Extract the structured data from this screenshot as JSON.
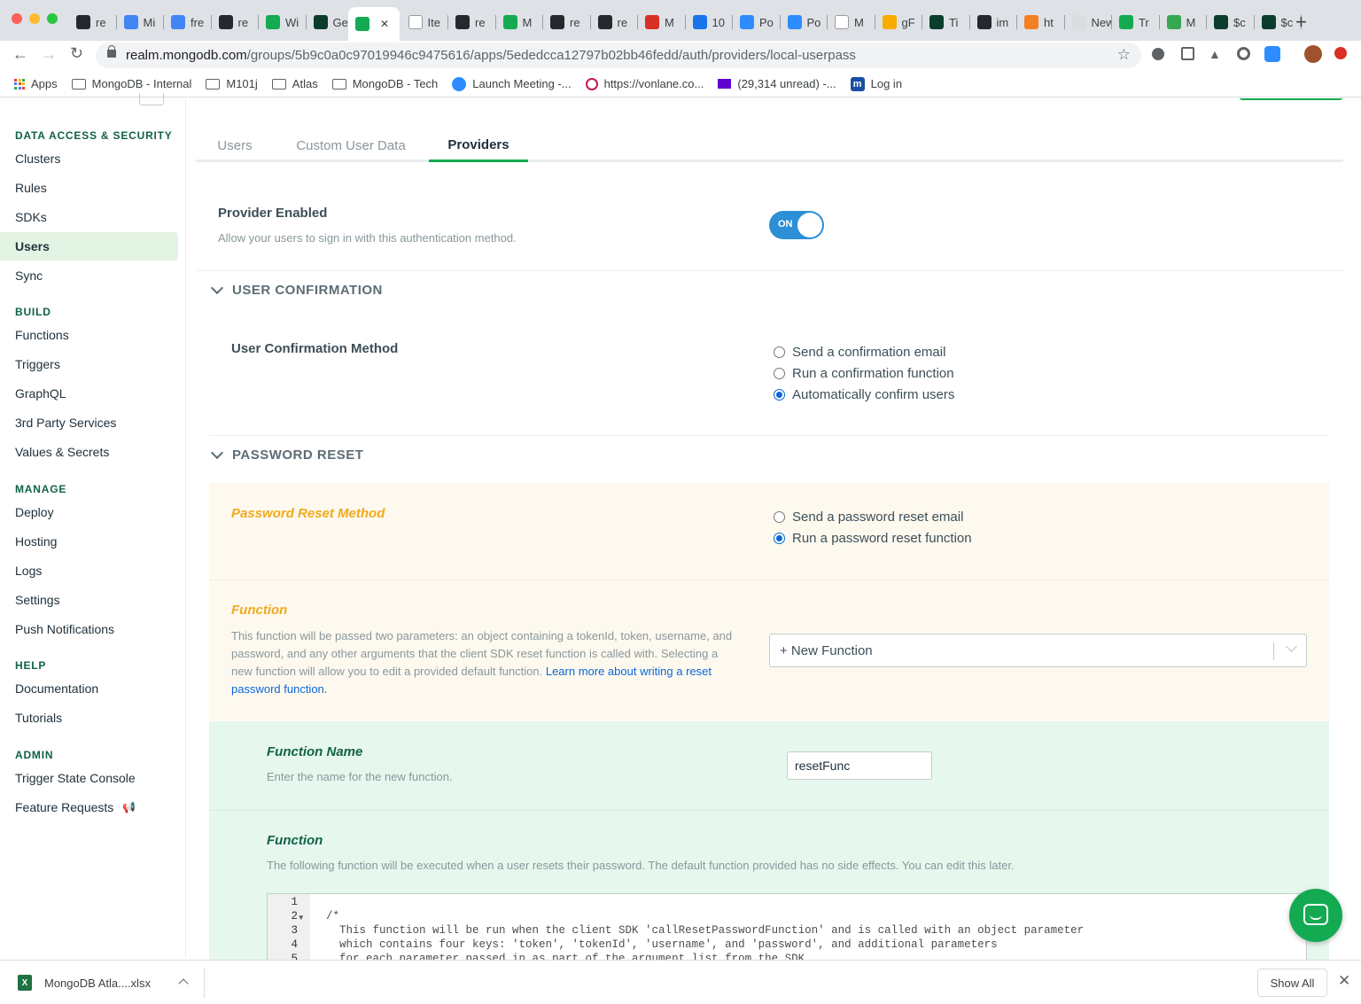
{
  "browser": {
    "tabs": [
      "re",
      "Mi",
      "fre",
      "re",
      "Wi",
      "Ge",
      "",
      "Ite",
      "re",
      "M",
      "re",
      "re",
      "M",
      "10",
      "Po",
      "Po",
      "M",
      "gF",
      "Ti",
      "im",
      "ht",
      "New T",
      "Tr",
      "M",
      "$c",
      "$c"
    ],
    "url_host": "realm.mongodb.com",
    "url_path": "/groups/5b9c0a0c97019946c9475616/apps/5ededcca12797b02bb46fedd/auth/providers/local-userpass",
    "bookmarks": [
      "Apps",
      "MongoDB - Internal",
      "M101j",
      "Atlas",
      "MongoDB  - Tech",
      "Launch Meeting -...",
      "https://vonlane.co...",
      "(29,314 unread) -...",
      "Log in"
    ]
  },
  "sidebar": {
    "sections": [
      {
        "title": "DATA ACCESS & SECURITY",
        "items": [
          "Clusters",
          "Rules",
          "SDKs",
          "Users",
          "Sync"
        ]
      },
      {
        "title": "BUILD",
        "items": [
          "Functions",
          "Triggers",
          "GraphQL",
          "3rd Party Services",
          "Values & Secrets"
        ]
      },
      {
        "title": "MANAGE",
        "items": [
          "Deploy",
          "Hosting",
          "Logs",
          "Settings",
          "Push Notifications"
        ]
      },
      {
        "title": "HELP",
        "items": [
          "Documentation",
          "Tutorials"
        ]
      },
      {
        "title": "ADMIN",
        "items": [
          "Trigger State Console",
          "Feature Requests"
        ]
      }
    ],
    "active_item": "Users"
  },
  "main": {
    "tabs": [
      "Users",
      "Custom User Data",
      "Providers"
    ],
    "active_tab": "Providers",
    "provider_enabled": {
      "label": "Provider Enabled",
      "description": "Allow your users to sign in with this authentication method.",
      "toggle_label": "ON"
    },
    "user_confirmation": {
      "section_title": "USER CONFIRMATION",
      "label": "User Confirmation Method",
      "options": [
        "Send a confirmation email",
        "Run a confirmation function",
        "Automatically confirm users"
      ],
      "selected": "Automatically confirm users"
    },
    "password_reset": {
      "section_title": "PASSWORD RESET",
      "method_label": "Password Reset Method",
      "options": [
        "Send a password reset email",
        "Run a password reset function"
      ],
      "selected": "Run a password reset function",
      "function_label": "Function",
      "function_desc": "This function will be passed two parameters: an object containing a tokenId, token, username, and password, and any other arguments that the client SDK reset function is called with. Selecting a new function will allow you to edit a provided default function.",
      "function_link": "Learn more about writing a reset password function.",
      "function_select_value": "+ New Function",
      "function_name_label": "Function Name",
      "function_name_desc": "Enter the name for the new function.",
      "function_name_value": "resetFunc",
      "editor_label": "Function",
      "editor_desc": "The following function will be executed when a user resets their password. The default function provided has no side effects. You can edit this later.",
      "code_lines": [
        {
          "num": "1",
          "fold": "",
          "text": ""
        },
        {
          "num": "2",
          "fold": "▾",
          "text": "/*"
        },
        {
          "num": "3",
          "fold": "",
          "text": "  This function will be run when the client SDK 'callResetPasswordFunction' and is called with an object parameter"
        },
        {
          "num": "4",
          "fold": "",
          "text": "  which contains four keys: 'token', 'tokenId', 'username', and 'password', and additional parameters"
        },
        {
          "num": "5",
          "fold": "",
          "text": "  for each parameter passed in as part of the argument list from the SDK."
        }
      ]
    }
  },
  "downloads": {
    "file_name": "MongoDB Atla....xlsx",
    "show_all": "Show All"
  },
  "colors": {
    "accent_green": "#13aa52",
    "dark_green": "#116149",
    "toggle_blue": "#2d8fd5",
    "warm_label": "#f0aa1c",
    "link_blue": "#0a67d8"
  }
}
